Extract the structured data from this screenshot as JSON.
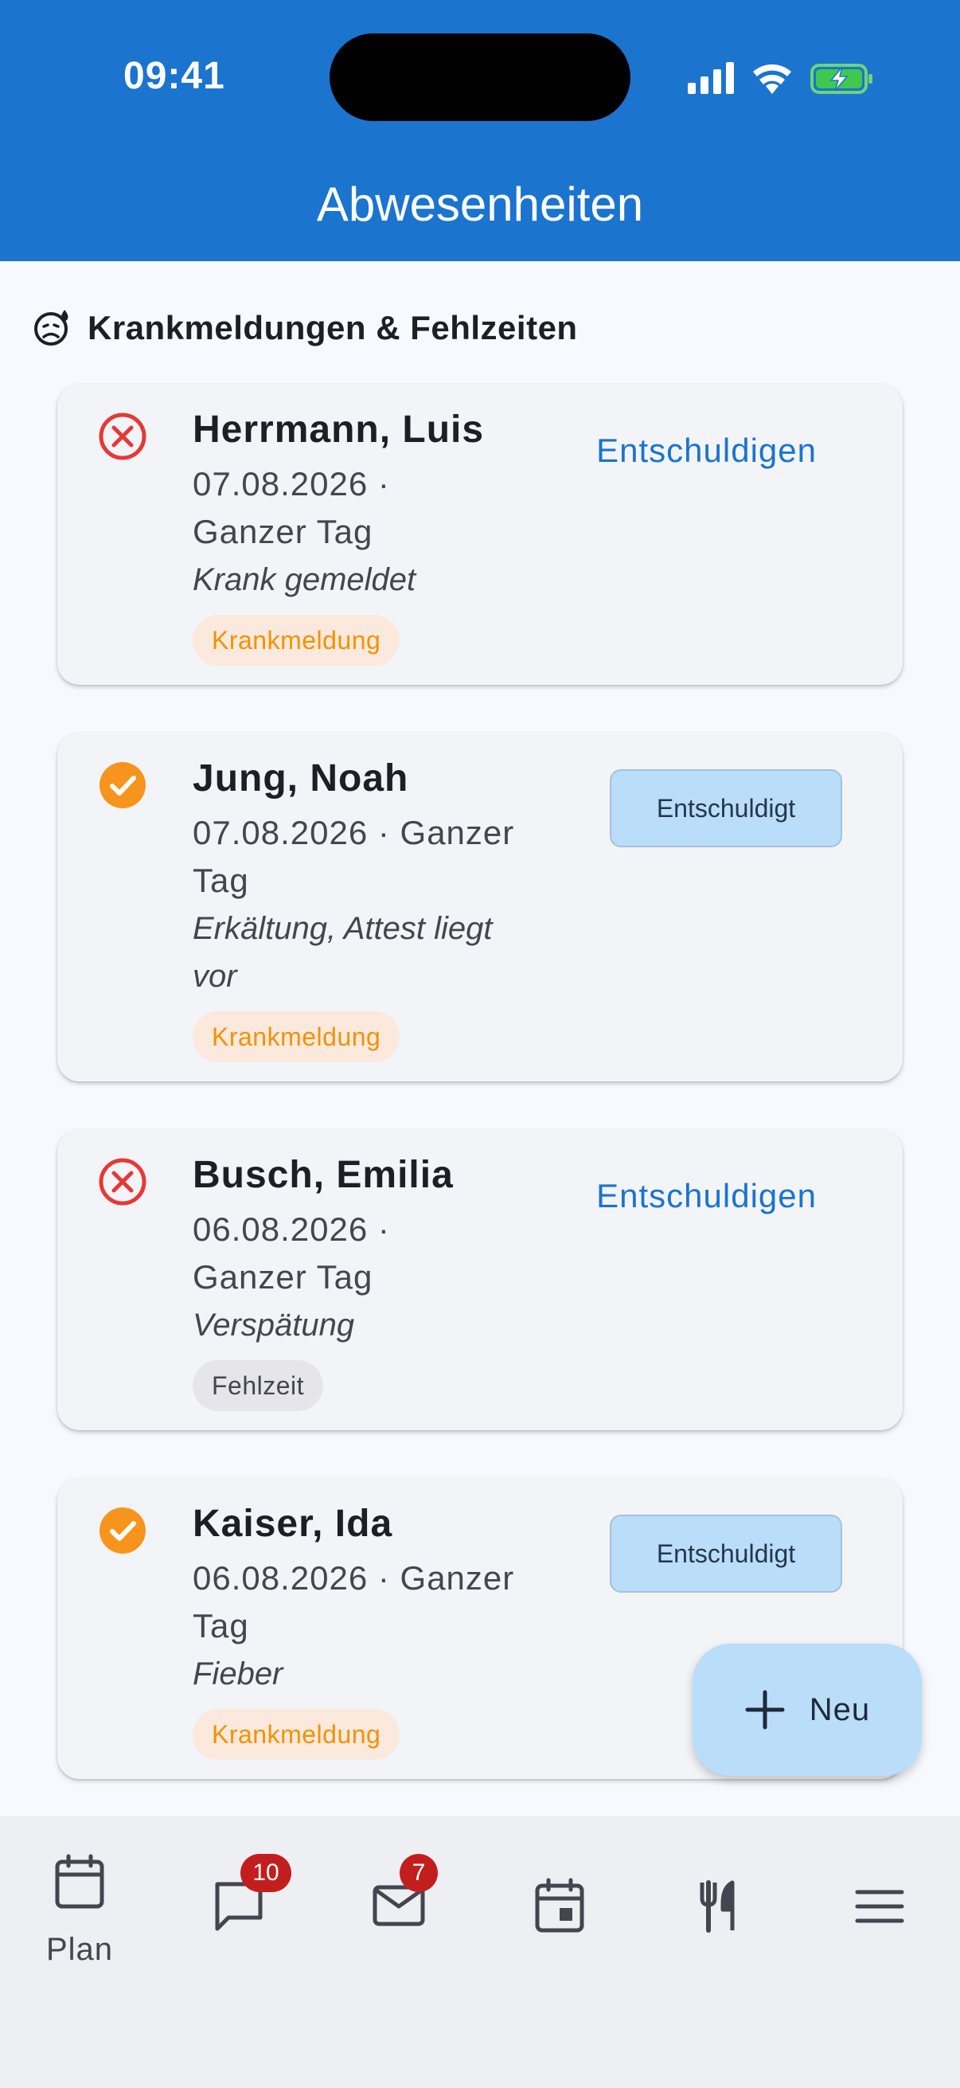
{
  "status_bar": {
    "time": "09:41"
  },
  "app_bar": {
    "title": "Abwesenheiten"
  },
  "section": {
    "title": "Krankmeldungen & Fehlzeiten",
    "icon": "sick-face-icon"
  },
  "records": [
    {
      "name": "Herrmann, Luis",
      "date_line1": "07.08.2026 ·",
      "date_line2": "Ganzer Tag",
      "note": "Krank gemeldet",
      "type": "Krankmeldung",
      "excused": false,
      "action": "Entschuldigen"
    },
    {
      "name": "Jung, Noah",
      "date_line1": "07.08.2026 · Ganzer",
      "date_line2": "Tag",
      "note_line1": "Erkältung, Attest liegt",
      "note_line2": "vor",
      "type": "Krankmeldung",
      "excused": true,
      "action": "Entschuldigt"
    },
    {
      "name": "Busch, Emilia",
      "date_line1": "06.08.2026 ·",
      "date_line2": "Ganzer Tag",
      "note": "Verspätung",
      "type": "Fehlzeit",
      "excused": false,
      "action": "Entschuldigen"
    },
    {
      "name": "Kaiser, Ida",
      "date_line1": "06.08.2026 · Ganzer",
      "date_line2": "Tag",
      "note": "Fieber",
      "type": "Krankmeldung",
      "excused": true,
      "action": "Entschuldigt"
    }
  ],
  "fab": {
    "label": "Neu",
    "icon": "plus-icon"
  },
  "bottom_nav": {
    "items": [
      {
        "id": "plan",
        "label": "Plan",
        "icon": "calendar-icon"
      },
      {
        "id": "chat",
        "icon": "chat-bubble-icon",
        "badge": "10"
      },
      {
        "id": "mail",
        "icon": "mail-icon",
        "badge": "7"
      },
      {
        "id": "events",
        "icon": "event-calendar-icon"
      },
      {
        "id": "food",
        "icon": "cutlery-icon"
      },
      {
        "id": "menu",
        "icon": "menu-icon"
      }
    ]
  },
  "colors": {
    "primary": "#1B74CE",
    "error": "#E53935",
    "warning": "#F7941D",
    "chip_sick_bg": "#FAE9DC",
    "chip_sick_text": "#F39200",
    "chip_absence_bg": "#E5E5EA",
    "tonal_button": "#BADDFA",
    "badge": "#C31E1E"
  }
}
